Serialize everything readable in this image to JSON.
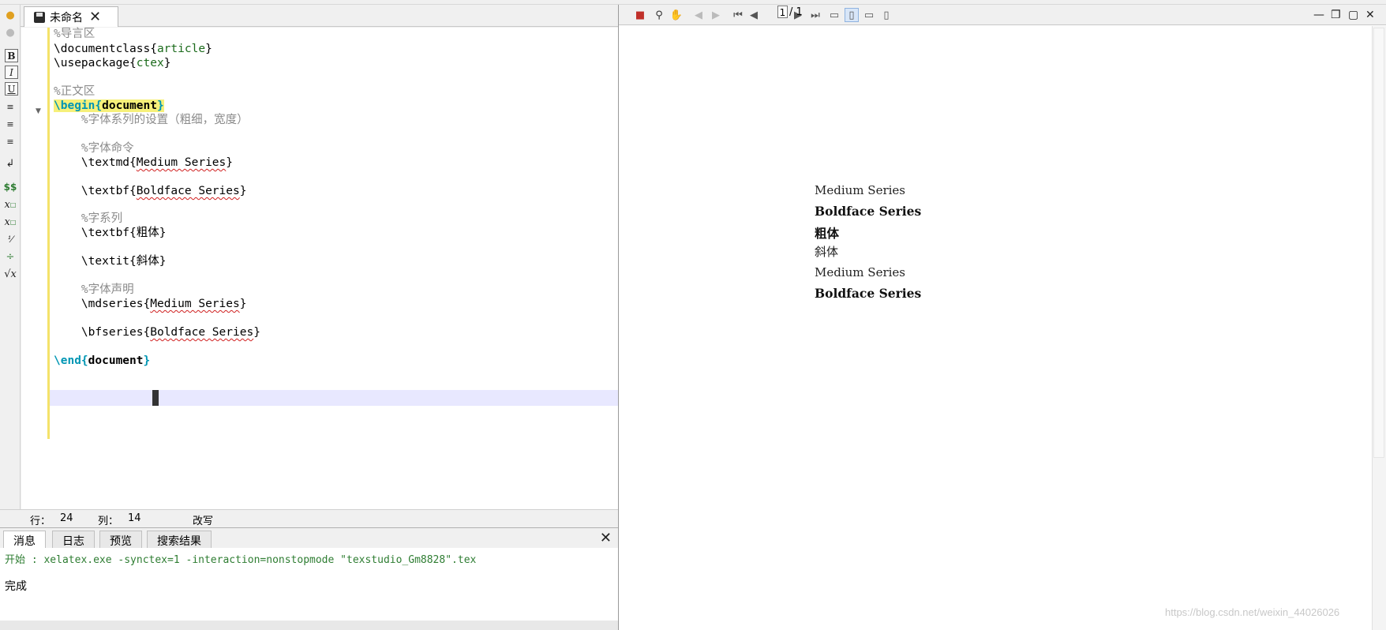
{
  "editor": {
    "tab_title": "未命名",
    "lines": [
      {
        "t": "comment",
        "text": "%导言区"
      },
      {
        "t": "cmdarg",
        "cmd": "\\documentclass",
        "arg": "article"
      },
      {
        "t": "cmdarg",
        "cmd": "\\usepackage",
        "arg": "ctex"
      },
      {
        "t": "blank"
      },
      {
        "t": "comment",
        "text": "%正文区"
      },
      {
        "t": "begin",
        "cmd": "\\begin",
        "arg": "document"
      },
      {
        "t": "comment",
        "text": "    %字体系列的设置（粗细，宽度）"
      },
      {
        "t": "blank"
      },
      {
        "t": "comment",
        "text": "    %字体命令"
      },
      {
        "t": "cmdtext",
        "cmd": "    \\textmd",
        "arg": "Medium Series"
      },
      {
        "t": "blank"
      },
      {
        "t": "cmdtext",
        "cmd": "    \\textbf",
        "arg": "Boldface Series"
      },
      {
        "t": "blank"
      },
      {
        "t": "comment",
        "text": "    %字系列"
      },
      {
        "t": "cmdtext",
        "cmd": "    \\textbf",
        "arg": "粗体"
      },
      {
        "t": "blank"
      },
      {
        "t": "cmdtext",
        "cmd": "    \\textit",
        "arg": "斜体"
      },
      {
        "t": "blank"
      },
      {
        "t": "comment",
        "text": "    %字体声明"
      },
      {
        "t": "cmdtext",
        "cmd": "    \\mdseries",
        "arg": "Medium Series"
      },
      {
        "t": "blank"
      },
      {
        "t": "cmdtext",
        "cmd": "    \\bfseries",
        "arg": "Boldface Series"
      },
      {
        "t": "blank"
      },
      {
        "t": "end",
        "cmd": "\\end",
        "arg": "document"
      }
    ]
  },
  "status": {
    "row_label": "行：",
    "row_value": "24",
    "col_label": "列：",
    "col_value": "14",
    "mode": "改写"
  },
  "messages": {
    "tabs": [
      "消息",
      "日志",
      "预览",
      "搜索结果"
    ],
    "line1": "开始 : xelatex.exe -synctex=1 -interaction=nonstopmode \"texstudio_Gm8828\".tex",
    "line2": "完成"
  },
  "pdf": {
    "page_current": "1",
    "page_total": "/ 1",
    "lines": [
      {
        "text": "Medium Series",
        "bold": false
      },
      {
        "text": "Boldface Series",
        "bold": true
      },
      {
        "text": "粗体",
        "bold": true
      },
      {
        "text": "斜体",
        "bold": false
      },
      {
        "text": "Medium Series",
        "bold": false
      },
      {
        "text": "Boldface Series",
        "bold": true
      }
    ]
  },
  "watermark": "https://blog.csdn.net/weixin_44026026",
  "colors": {
    "keyword": "#0096b4",
    "argument": "#1c6b1c",
    "comment": "#8a8a8a",
    "current_line": "#e8e8ff",
    "message_green": "#2e7d32"
  },
  "icons": [
    "save-icon",
    "close-icon",
    "bold-icon",
    "italic-icon",
    "underline-icon",
    "align-left-icon",
    "align-center-icon",
    "align-right-icon",
    "newline-icon",
    "inline-math-icon",
    "subscript-icon",
    "superscript-icon",
    "frac-icon",
    "sqrt-icon",
    "pdf-icon",
    "zoom-icon",
    "hand-icon",
    "first-page-icon",
    "prev-page-icon",
    "next-page-icon",
    "last-page-icon"
  ]
}
